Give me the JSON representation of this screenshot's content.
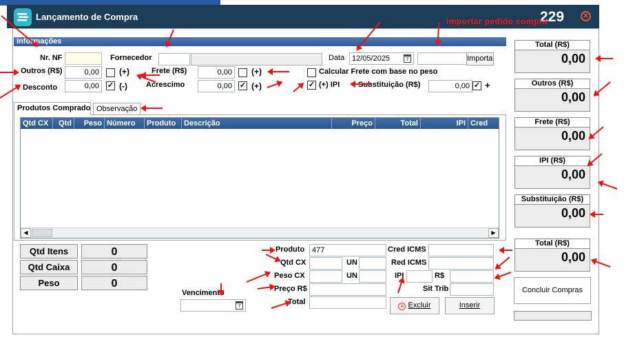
{
  "window": {
    "title": "Lançamento de Compra",
    "counter": "229",
    "close_glyph": "✕",
    "annotation": "importar pedido compra"
  },
  "info": {
    "section_title": "Informações",
    "nf_label": "Nr. NF",
    "nf_value": "",
    "fornecedor_label": "Fornecedor",
    "fornecedor_code": "",
    "fornecedor_name": "",
    "data_label": "Data",
    "data_value": "12/05/2025",
    "importar_value": "",
    "importar_label": "Importar",
    "outros_label": "Outros (R$)",
    "outros_value": "0,00",
    "outros_checked": false,
    "outros_sign": "(+)",
    "frete_label": "Frete (R$)",
    "frete_value": "0,00",
    "frete_checked": false,
    "frete_sign": "(+)",
    "calc_frete_label": "Calcular Frete com base no peso",
    "calc_frete_checked": false,
    "desconto_label": "Desconto",
    "desconto_value": "0,00",
    "desconto_checked": true,
    "desconto_sign": "(-)",
    "acrescimo_label": "Acrescimo",
    "acrescimo_value": "0,00",
    "acrescimo_checked": true,
    "acrescimo_sign": "(+)",
    "ipi_checked": true,
    "ipi_label": "(+) IPI",
    "subst_label": "Substituição (R$)",
    "subst_value": "0,00",
    "subst_checked": true,
    "subst_sign": "+"
  },
  "tabs": [
    {
      "label": "Produtos Comprados",
      "active": true
    },
    {
      "label": "Observação",
      "active": false
    }
  ],
  "grid": {
    "columns": [
      "Qtd CX",
      "Qtd",
      "Peso",
      "Número",
      "Produto",
      "Descrição",
      "Preço",
      "Total",
      "IPI",
      "Cred"
    ],
    "rows": []
  },
  "summary": {
    "qtd_itens_label": "Qtd Itens",
    "qtd_itens_value": "0",
    "qtd_caixa_label": "Qtd Caixa",
    "qtd_caixa_value": "0",
    "peso_label": "Peso",
    "peso_value": "0"
  },
  "vencimento": {
    "label": "Vencimento",
    "value": ""
  },
  "item": {
    "produto_label": "Produto",
    "produto_value": "477",
    "qtd_cx_label": "Qtd CX",
    "un_label": "UN",
    "peso_cx_label": "Peso CX",
    "preco_label": "Preço R$",
    "total_label": "Total",
    "cred_icms_label": "Cred ICMS",
    "red_icms_label": "Red ICMS",
    "ipi_label": "IPI",
    "rs_label": "R$",
    "sit_trib_label": "Sit Trib",
    "excluir_label": "Excluir",
    "inserir_label": "Inserir"
  },
  "totals": [
    {
      "label": "Total (R$)",
      "value": "0,00"
    },
    {
      "label": "Outros (R$)",
      "value": "0,00"
    },
    {
      "label": "Frete (R$)",
      "value": "0,00"
    },
    {
      "label": "IPI (R$)",
      "value": "0,00"
    },
    {
      "label": "Substituição (R$)",
      "value": "0,00"
    },
    {
      "label": "Total (R$)",
      "value": "0,00"
    }
  ],
  "concluir_label": "Concluir Compras",
  "colors": {
    "titlebar": "#1c3d57",
    "header": "#2f5d9c",
    "annotation": "#ee1111",
    "close": "#e8582a"
  }
}
